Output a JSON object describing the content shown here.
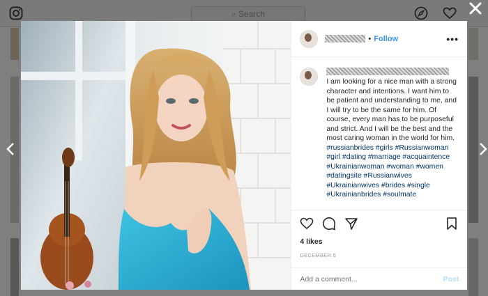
{
  "header": {
    "search_placeholder": "Search"
  },
  "post": {
    "follow_label": "Follow",
    "separator": "•",
    "more_label": "•••",
    "caption": "I am looking for a nice man with a strong character and intentions. I want him to be patient and understanding to me, and I will try to be the same for him. Of course, every man has to be purposeful and strict. And I will be the best and the most caring woman in the world for him.",
    "hashtags": "#russianbrides #girls #Russianwoman #girl #dating #marriage #acquaintence #Ukrainianwoman #woman #women #datingsite #Russianwives #Ukrainianwives #brides #single #Ukrainianbrides #soulmate",
    "likes": "4 likes",
    "date": "DECEMBER 5",
    "comment_placeholder": "Add a comment...",
    "post_label": "Post"
  },
  "colors": {
    "link_blue": "#3897f0",
    "hashtag_blue": "#003569",
    "dress_teal": "#2fb4d6"
  },
  "icons": [
    "instagram-logo-icon",
    "search-icon",
    "compass-icon",
    "heart-icon",
    "close-icon",
    "chevron-left-icon",
    "chevron-right-icon",
    "comment-icon",
    "share-icon",
    "bookmark-icon"
  ]
}
